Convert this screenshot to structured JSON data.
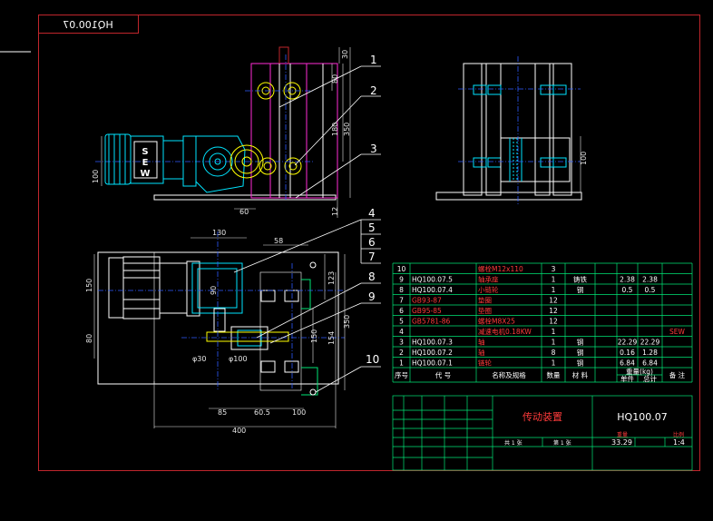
{
  "drawing": {
    "stamp": "HQ100.07",
    "colors": {
      "background": "#000000",
      "frame": "#c0262c",
      "object": "#ffffff",
      "table": "#00e676",
      "dimension": "#e6e6e6",
      "center": "#2f5bff",
      "motor": "#00e5ff",
      "hidden": "#ff2bd6",
      "gear": "#ffff00"
    },
    "callouts": [
      "1",
      "2",
      "3",
      "4",
      "5",
      "6",
      "7",
      "8",
      "9",
      "10"
    ],
    "dims_front": {
      "d30": "30",
      "d80": "80",
      "d180": "180",
      "d350": "350",
      "d12": "12",
      "d60": "60",
      "d100": "100"
    },
    "dims_plan": {
      "d130": "130",
      "d58": "58",
      "d90": "90",
      "d150": "150",
      "d80": "80",
      "d123": "123",
      "d154": "154",
      "d350": "350",
      "d150b": "150",
      "phi30": "φ30",
      "phi100": "φ100",
      "d85": "85",
      "d60_5": "60.5",
      "d100": "100",
      "d400": "400"
    },
    "dims_side": {
      "d100": "100"
    },
    "bom": {
      "rows": [
        {
          "no": "10",
          "code": "",
          "name": "螺栓M12x110",
          "qty": "3",
          "mat": "",
          "w1": "",
          "w2": "",
          "note": ""
        },
        {
          "no": "9",
          "code": "HQ100.07.5",
          "name": "轴承座",
          "qty": "1",
          "mat": "铸铁",
          "w1": "2.38",
          "w2": "2.38",
          "note": ""
        },
        {
          "no": "8",
          "code": "HQ100.07.4",
          "name": "小链轮",
          "qty": "1",
          "mat": "钢",
          "w1": "0.5",
          "w2": "0.5",
          "note": ""
        },
        {
          "no": "7",
          "code": "GB93-87",
          "name": "垫圈",
          "qty": "12",
          "mat": "",
          "w1": "",
          "w2": "",
          "note": ""
        },
        {
          "no": "6",
          "code": "GB95-85",
          "name": "垫圈",
          "qty": "12",
          "mat": "",
          "w1": "",
          "w2": "",
          "note": ""
        },
        {
          "no": "5",
          "code": "GB5781-86",
          "name": "螺栓M8X25",
          "qty": "12",
          "mat": "",
          "w1": "",
          "w2": "",
          "note": ""
        },
        {
          "no": "4",
          "code": "",
          "name": "减速电机0.18KW",
          "qty": "1",
          "mat": "",
          "w1": "",
          "w2": "",
          "note": "SEW"
        },
        {
          "no": "3",
          "code": "HQ100.07.3",
          "name": "轴",
          "qty": "1",
          "mat": "钢",
          "w1": "22.29",
          "w2": "22.29",
          "note": ""
        },
        {
          "no": "2",
          "code": "HQ100.07.2",
          "name": "轴",
          "qty": "8",
          "mat": "钢",
          "w1": "0.16",
          "w2": "1.28",
          "note": ""
        },
        {
          "no": "1",
          "code": "HQ100.07.1",
          "name": "链轮",
          "qty": "1",
          "mat": "钢",
          "w1": "6.84",
          "w2": "6.84",
          "note": ""
        }
      ],
      "header": {
        "no": "序号",
        "code": "代 号",
        "name": "名称及规格",
        "qty": "数量",
        "mat": "材 料",
        "w": "重量(kg)",
        "w1": "单件",
        "w2": "总计",
        "note": "备 注"
      }
    },
    "title_block": {
      "part_name": "传动装置",
      "drawing_no": "HQ100.07",
      "weight": "33.29",
      "scale": "1:4",
      "sheet_left": "共 1 张",
      "sheet_right": "第 1 张",
      "label_weight": "重量",
      "label_scale": "比例"
    }
  }
}
